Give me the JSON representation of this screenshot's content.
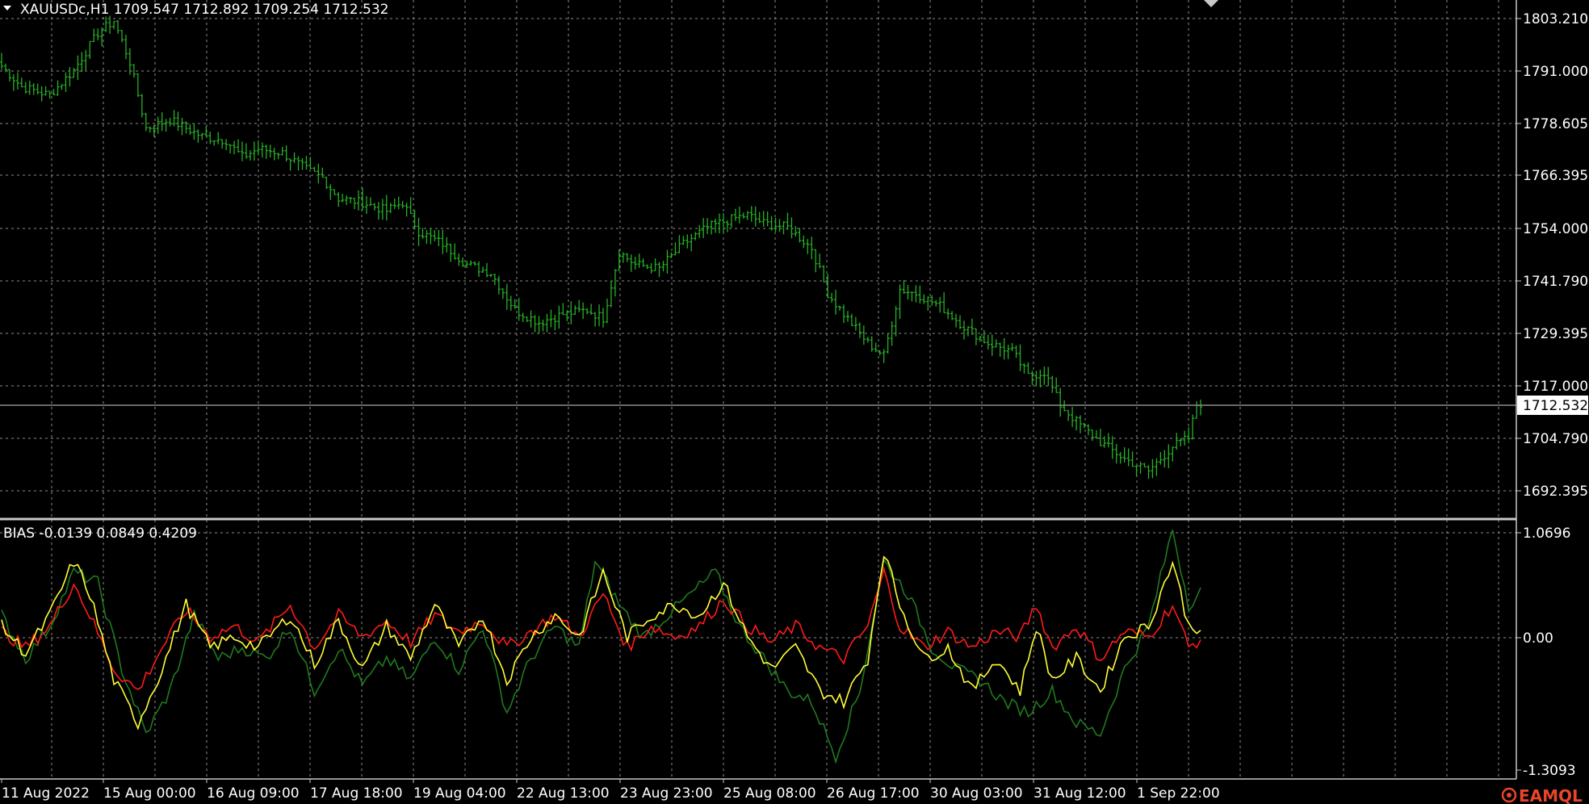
{
  "header": {
    "symbol_info": "XAUUSDc,H1  1709.547 1712.892 1709.254 1712.532",
    "indicator_info": "BIAS -0.0139 0.0849 0.4209"
  },
  "price_axis": {
    "labels": [
      "1803.210",
      "1791.000",
      "1778.605",
      "1766.395",
      "1754.000",
      "1741.790",
      "1729.395",
      "1717.000",
      "1704.790",
      "1692.395"
    ],
    "current_price": "1712.532"
  },
  "indicator_axis": {
    "labels": [
      "1.0696",
      "0.00",
      "-1.3093"
    ]
  },
  "time_axis": {
    "labels": [
      "11 Aug 2022",
      "15 Aug 00:00",
      "16 Aug 09:00",
      "17 Aug 18:00",
      "19 Aug 04:00",
      "22 Aug 13:00",
      "23 Aug 23:00",
      "25 Aug 08:00",
      "26 Aug 17:00",
      "30 Aug 03:00",
      "31 Aug 12:00",
      "1 Sep 22:00"
    ]
  },
  "logo": {
    "text": "EAMQL"
  },
  "colors": {
    "background": "#000000",
    "grid": "#8c8c8c",
    "bars": "#26b126",
    "bias_short": "#ff1a1a",
    "bias_mid": "#ffff33",
    "bias_long": "#1f7a1f",
    "logo": "#e8452b"
  },
  "chart_data": [
    {
      "type": "ohlc",
      "title": "XAUUSDc,H1",
      "ylim": [
        1686,
        1811
      ],
      "x_count": 300,
      "close_anchors": [
        [
          0,
          1795
        ],
        [
          5,
          1790
        ],
        [
          12,
          1788
        ],
        [
          18,
          1794
        ],
        [
          24,
          1803
        ],
        [
          28,
          1806
        ],
        [
          32,
          1796
        ],
        [
          36,
          1780
        ],
        [
          42,
          1782
        ],
        [
          50,
          1778
        ],
        [
          56,
          1777
        ],
        [
          60,
          1773
        ],
        [
          64,
          1775
        ],
        [
          70,
          1774
        ],
        [
          76,
          1770
        ],
        [
          80,
          1768
        ],
        [
          84,
          1763
        ],
        [
          90,
          1762
        ],
        [
          96,
          1760
        ],
        [
          100,
          1762
        ],
        [
          104,
          1755
        ],
        [
          110,
          1752
        ],
        [
          116,
          1747
        ],
        [
          122,
          1745
        ],
        [
          128,
          1736
        ],
        [
          134,
          1733
        ],
        [
          140,
          1735
        ],
        [
          146,
          1736
        ],
        [
          150,
          1734
        ],
        [
          154,
          1750
        ],
        [
          158,
          1747
        ],
        [
          164,
          1746
        ],
        [
          170,
          1752
        ],
        [
          176,
          1756
        ],
        [
          182,
          1758
        ],
        [
          186,
          1759
        ],
        [
          190,
          1757
        ],
        [
          196,
          1756
        ],
        [
          202,
          1751
        ],
        [
          206,
          1740
        ],
        [
          210,
          1735
        ],
        [
          216,
          1728
        ],
        [
          220,
          1725
        ],
        [
          224,
          1741
        ],
        [
          228,
          1740
        ],
        [
          234,
          1737
        ],
        [
          240,
          1732
        ],
        [
          246,
          1728
        ],
        [
          252,
          1726
        ],
        [
          256,
          1720
        ],
        [
          260,
          1721
        ],
        [
          264,
          1713
        ],
        [
          268,
          1709
        ],
        [
          274,
          1704
        ],
        [
          280,
          1700
        ],
        [
          286,
          1697
        ],
        [
          292,
          1703
        ],
        [
          296,
          1705
        ],
        [
          298,
          1713
        ]
      ],
      "last_close": 1712.532
    },
    {
      "type": "line",
      "title": "BIAS",
      "ylim": [
        -1.3093,
        1.0696
      ],
      "x_count": 300,
      "series": [
        {
          "name": "-0.0139",
          "color": "#ff1a1a",
          "anchors": [
            [
              0,
              0.05
            ],
            [
              6,
              -0.1
            ],
            [
              12,
              0.1
            ],
            [
              18,
              0.5
            ],
            [
              22,
              0.2
            ],
            [
              28,
              -0.3
            ],
            [
              34,
              -0.5
            ],
            [
              40,
              -0.1
            ],
            [
              46,
              0.25
            ],
            [
              52,
              0.0
            ],
            [
              58,
              0.1
            ],
            [
              64,
              -0.05
            ],
            [
              72,
              0.3
            ],
            [
              78,
              -0.1
            ],
            [
              84,
              0.2
            ],
            [
              90,
              0.0
            ],
            [
              96,
              0.15
            ],
            [
              102,
              -0.05
            ],
            [
              108,
              0.2
            ],
            [
              114,
              0.05
            ],
            [
              120,
              0.15
            ],
            [
              126,
              -0.1
            ],
            [
              132,
              0.05
            ],
            [
              138,
              0.2
            ],
            [
              144,
              0.0
            ],
            [
              150,
              0.4
            ],
            [
              156,
              -0.1
            ],
            [
              162,
              0.1
            ],
            [
              168,
              0.0
            ],
            [
              174,
              0.1
            ],
            [
              180,
              0.35
            ],
            [
              186,
              0.1
            ],
            [
              192,
              -0.05
            ],
            [
              198,
              0.1
            ],
            [
              204,
              -0.1
            ],
            [
              210,
              -0.2
            ],
            [
              216,
              0.1
            ],
            [
              220,
              0.6
            ],
            [
              224,
              0.1
            ],
            [
              230,
              -0.1
            ],
            [
              236,
              0.05
            ],
            [
              242,
              -0.1
            ],
            [
              248,
              0.05
            ],
            [
              254,
              0.0
            ],
            [
              258,
              0.3
            ],
            [
              262,
              -0.1
            ],
            [
              268,
              0.1
            ],
            [
              274,
              -0.2
            ],
            [
              280,
              0.05
            ],
            [
              286,
              0.0
            ],
            [
              292,
              0.3
            ],
            [
              296,
              -0.1
            ],
            [
              299,
              -0.0139
            ]
          ]
        },
        {
          "name": "0.0849",
          "color": "#ffff33",
          "anchors": [
            [
              0,
              0.1
            ],
            [
              6,
              -0.15
            ],
            [
              12,
              0.2
            ],
            [
              18,
              0.7
            ],
            [
              22,
              0.4
            ],
            [
              28,
              -0.4
            ],
            [
              34,
              -0.8
            ],
            [
              40,
              -0.3
            ],
            [
              46,
              0.3
            ],
            [
              52,
              -0.1
            ],
            [
              58,
              0.0
            ],
            [
              64,
              -0.1
            ],
            [
              72,
              0.2
            ],
            [
              78,
              -0.25
            ],
            [
              84,
              0.15
            ],
            [
              90,
              -0.3
            ],
            [
              96,
              0.1
            ],
            [
              102,
              -0.2
            ],
            [
              108,
              0.3
            ],
            [
              114,
              -0.1
            ],
            [
              120,
              0.2
            ],
            [
              126,
              -0.4
            ],
            [
              132,
              0.0
            ],
            [
              138,
              0.2
            ],
            [
              144,
              0.0
            ],
            [
              150,
              0.6
            ],
            [
              156,
              0.0
            ],
            [
              162,
              0.2
            ],
            [
              168,
              0.3
            ],
            [
              174,
              0.2
            ],
            [
              180,
              0.5
            ],
            [
              186,
              0.0
            ],
            [
              192,
              -0.3
            ],
            [
              198,
              -0.1
            ],
            [
              204,
              -0.5
            ],
            [
              210,
              -0.6
            ],
            [
              216,
              -0.2
            ],
            [
              220,
              0.8
            ],
            [
              224,
              0.3
            ],
            [
              230,
              -0.2
            ],
            [
              236,
              -0.1
            ],
            [
              242,
              -0.5
            ],
            [
              248,
              -0.2
            ],
            [
              254,
              -0.5
            ],
            [
              258,
              0.1
            ],
            [
              262,
              -0.4
            ],
            [
              268,
              -0.2
            ],
            [
              274,
              -0.5
            ],
            [
              280,
              0.0
            ],
            [
              286,
              0.1
            ],
            [
              292,
              0.7
            ],
            [
              296,
              0.1
            ],
            [
              299,
              0.0849
            ]
          ]
        },
        {
          "name": "0.4209",
          "color": "#1f7a1f",
          "anchors": [
            [
              0,
              0.2
            ],
            [
              6,
              -0.2
            ],
            [
              12,
              0.1
            ],
            [
              18,
              0.6
            ],
            [
              24,
              0.5
            ],
            [
              30,
              -0.3
            ],
            [
              36,
              -0.9
            ],
            [
              42,
              -0.5
            ],
            [
              48,
              0.2
            ],
            [
              54,
              -0.2
            ],
            [
              60,
              -0.1
            ],
            [
              66,
              -0.2
            ],
            [
              72,
              0.1
            ],
            [
              78,
              -0.5
            ],
            [
              84,
              -0.1
            ],
            [
              90,
              -0.45
            ],
            [
              96,
              -0.2
            ],
            [
              102,
              -0.4
            ],
            [
              108,
              0.0
            ],
            [
              114,
              -0.3
            ],
            [
              120,
              0.1
            ],
            [
              126,
              -0.7
            ],
            [
              132,
              -0.2
            ],
            [
              138,
              0.1
            ],
            [
              144,
              -0.1
            ],
            [
              148,
              0.7
            ],
            [
              154,
              0.3
            ],
            [
              160,
              0.0
            ],
            [
              166,
              0.2
            ],
            [
              172,
              0.4
            ],
            [
              178,
              0.6
            ],
            [
              184,
              0.1
            ],
            [
              190,
              -0.2
            ],
            [
              196,
              -0.5
            ],
            [
              202,
              -0.6
            ],
            [
              208,
              -1.1
            ],
            [
              214,
              -0.5
            ],
            [
              220,
              0.7
            ],
            [
              226,
              0.4
            ],
            [
              232,
              -0.1
            ],
            [
              238,
              -0.3
            ],
            [
              244,
              -0.4
            ],
            [
              250,
              -0.6
            ],
            [
              256,
              -0.7
            ],
            [
              262,
              -0.5
            ],
            [
              268,
              -0.8
            ],
            [
              274,
              -0.9
            ],
            [
              280,
              -0.3
            ],
            [
              286,
              0.1
            ],
            [
              292,
              1.0
            ],
            [
              296,
              0.3
            ],
            [
              299,
              0.4209
            ]
          ]
        }
      ]
    }
  ]
}
